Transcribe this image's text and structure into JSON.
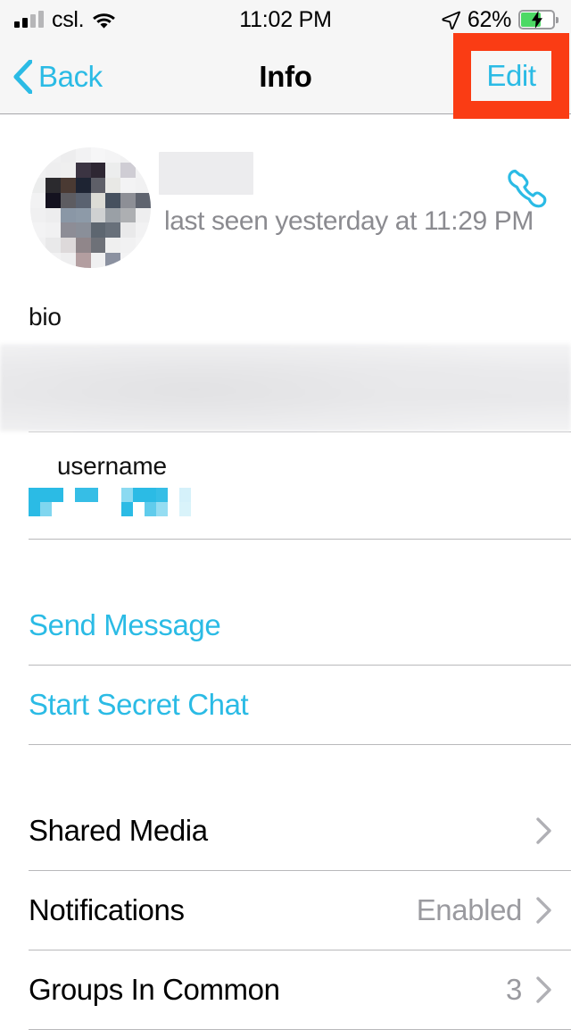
{
  "status_bar": {
    "carrier": "csl.",
    "time": "11:02 PM",
    "battery_percent": "62%",
    "battery_level": 62,
    "charging": true,
    "signal_bars_active": 2,
    "signal_bars_total": 4,
    "icons": {
      "signal": "signal-bars-icon",
      "wifi": "wifi-icon",
      "location": "location-arrow-icon",
      "battery": "battery-charging-icon"
    }
  },
  "nav": {
    "back_label": "Back",
    "title": "Info",
    "edit_label": "Edit",
    "highlight_color": "#fa3c14",
    "tint_color": "#2bbbe5"
  },
  "contact": {
    "name_redacted": true,
    "avatar_redacted": true,
    "status": "last seen yesterday at 11:29 PM",
    "call_action": "call-icon"
  },
  "fields": {
    "bio_label": "bio",
    "bio_value_redacted": true,
    "username_label": "username",
    "username_value_redacted": true
  },
  "actions": [
    {
      "label": "Send Message",
      "name": "send-message-button"
    },
    {
      "label": "Start Secret Chat",
      "name": "start-secret-chat-button"
    }
  ],
  "list_rows": [
    {
      "label": "Shared Media",
      "value": "",
      "name": "shared-media-row"
    },
    {
      "label": "Notifications",
      "value": "Enabled",
      "name": "notifications-row"
    },
    {
      "label": "Groups In Common",
      "value": "3",
      "name": "groups-in-common-row"
    }
  ],
  "colors": {
    "tint": "#2bbbe5",
    "secondary_text": "#8b8b90",
    "separator": "#b9b9bb",
    "bar_background": "#f6f6f6",
    "battery_green": "#4cd964",
    "highlight": "#fa3c14"
  }
}
